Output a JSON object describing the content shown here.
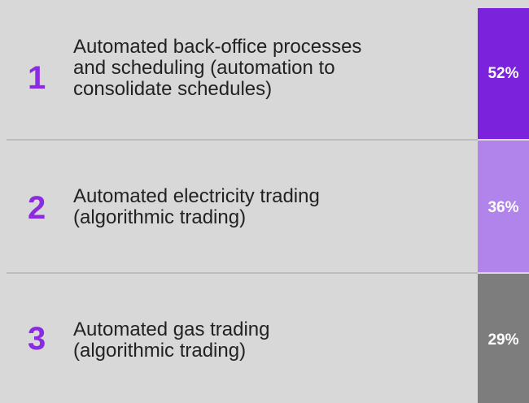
{
  "colors": {
    "background": "#d8d8d8",
    "rank_text": "#8a2be2",
    "divider": "#bcbcbc",
    "bar_colors": [
      "#7a22dc",
      "#b084ea",
      "#7d7d7d"
    ]
  },
  "rows": [
    {
      "rank": "1",
      "label_lines": [
        "Automated back-office processes",
        "and scheduling (automation to",
        "consolidate schedules)"
      ],
      "value_label": "52%"
    },
    {
      "rank": "2",
      "label_lines": [
        "Automated electricity trading",
        "(algorithmic trading)"
      ],
      "value_label": "36%"
    },
    {
      "rank": "3",
      "label_lines": [
        "Automated gas trading",
        "(algorithmic trading)"
      ],
      "value_label": "29%"
    }
  ],
  "chart_data": {
    "type": "table",
    "categories": [
      "Automated back-office processes and scheduling (automation to consolidate schedules)",
      "Automated electricity trading (algorithmic trading)",
      "Automated gas trading (algorithmic trading)"
    ],
    "ranks": [
      1,
      2,
      3
    ],
    "values": [
      52,
      36,
      29
    ],
    "unit": "%"
  }
}
